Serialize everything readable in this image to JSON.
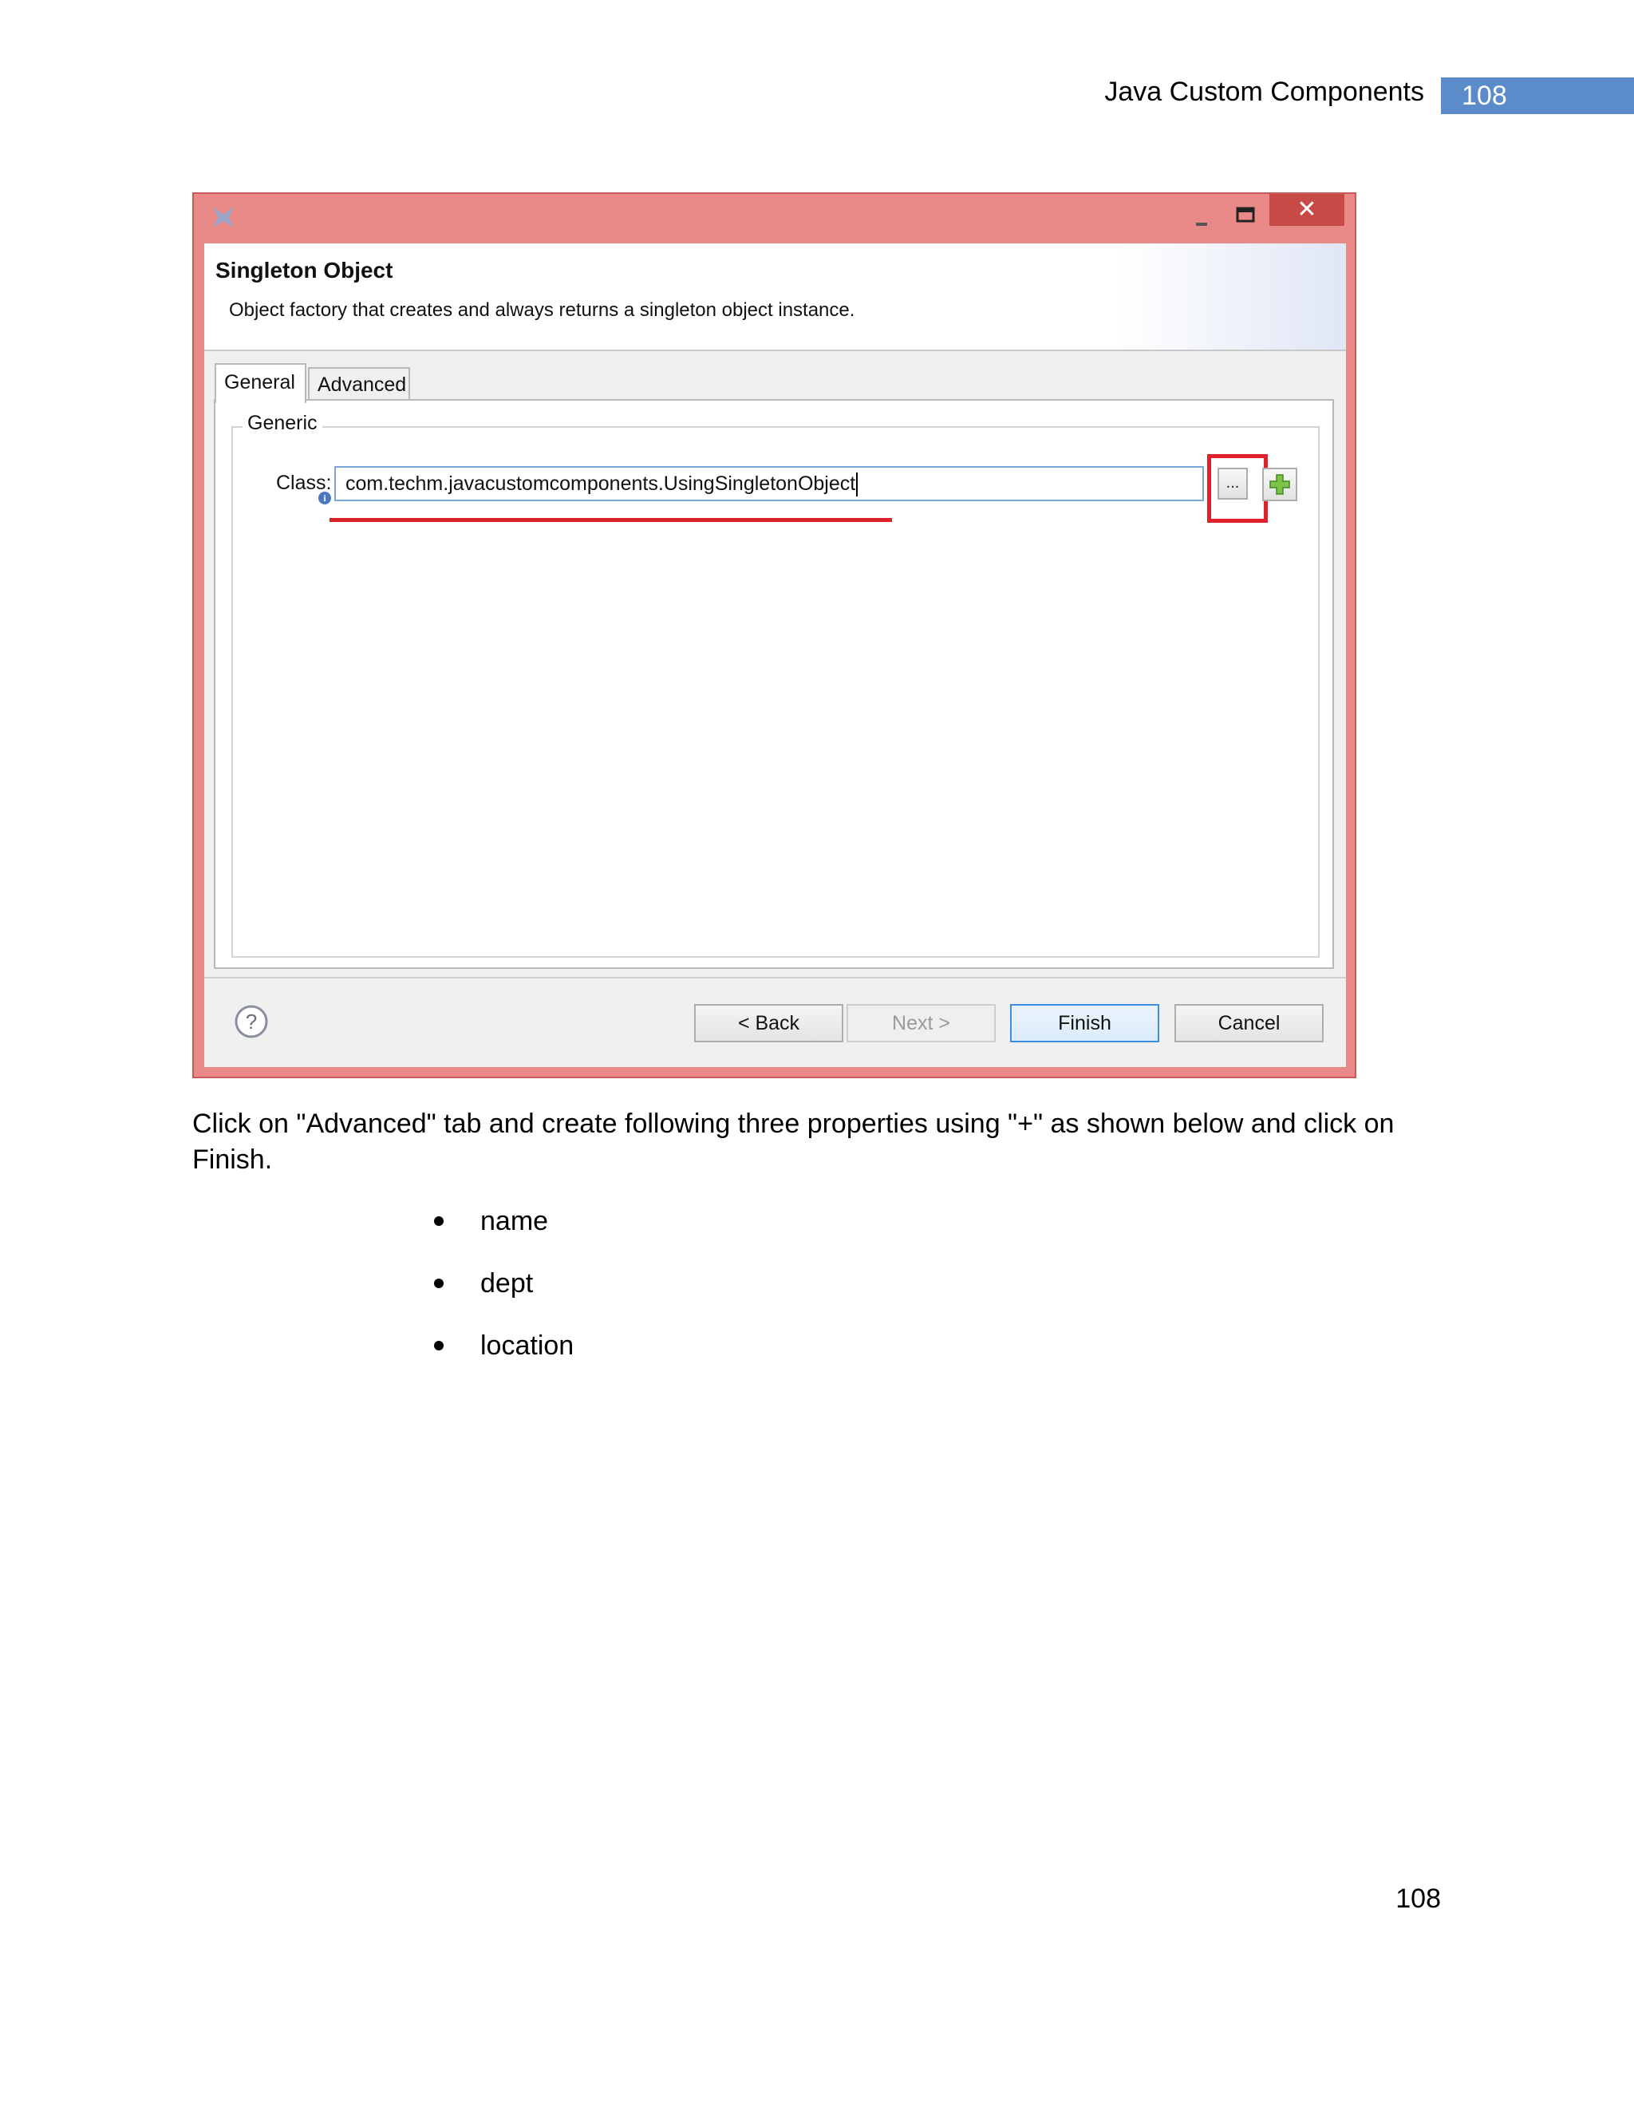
{
  "header": {
    "title": "Java Custom Components",
    "page_badge": "108"
  },
  "dialog": {
    "title": "Singleton Object",
    "description": "Object factory that creates and always returns a singleton object instance.",
    "tabs": [
      "General",
      "Advanced"
    ],
    "active_tab": "General",
    "group_label": "Generic",
    "class_label": "Class:",
    "class_value": "com.techm.javacustomcomponents.UsingSingletonObject",
    "browse_label": "...",
    "buttons": {
      "back": "< Back",
      "next": "Next >",
      "finish": "Finish",
      "cancel": "Cancel"
    },
    "window_controls": {
      "close": "✕"
    }
  },
  "body": {
    "instruction": "Click on \"Advanced\" tab and create following three properties using \"+\" as shown below and click on Finish.",
    "properties": [
      "name",
      "dept",
      "location"
    ]
  },
  "footer": {
    "page_number": "108"
  },
  "colors": {
    "window_border": "#e98988",
    "highlight": "#e0202a",
    "badge": "#5b8bc9"
  }
}
